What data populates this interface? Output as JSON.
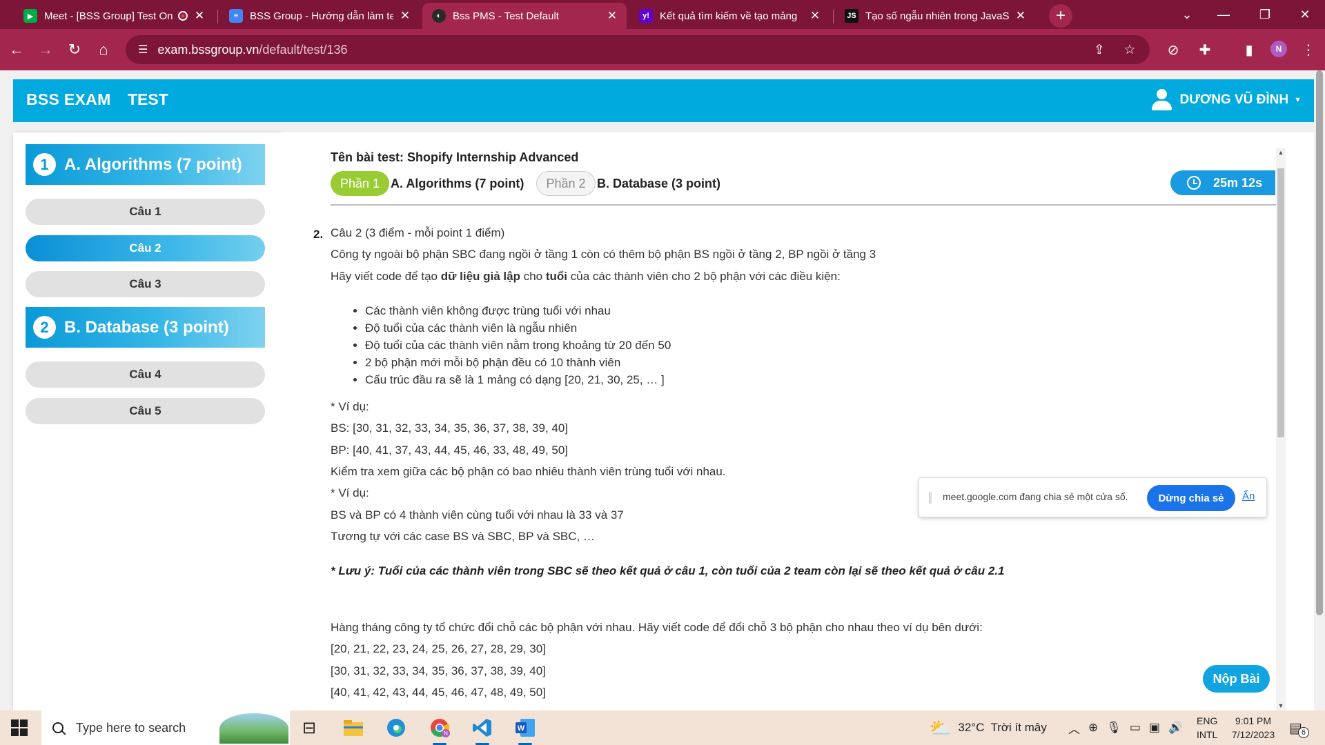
{
  "browser": {
    "tabs": [
      {
        "title": "Meet - [BSS Group] Test On",
        "favicon": "google-meet-icon",
        "color": "#00ac47",
        "recording": true,
        "active": false
      },
      {
        "title": "BSS Group - Hướng dẫn làm tes",
        "favicon": "google-docs-icon",
        "color": "#4285f4",
        "active": false
      },
      {
        "title": "Bss PMS - Test Default",
        "favicon": "bss-icon",
        "color": "#2a2a2a",
        "active": true
      },
      {
        "title": "Kết quả tìm kiếm về tạo mảng",
        "favicon": "yahoo-icon",
        "color": "#6001d2",
        "active": false
      },
      {
        "title": "Tạo số ngẫu nhiên trong JavaSc",
        "favicon": "js-icon",
        "color": "#111111",
        "active": false
      }
    ],
    "url_host": "exam.bssgroup.vn",
    "url_path": "/default/test/136",
    "profile_initial": "N"
  },
  "app": {
    "brand": "BSS EXAM",
    "nav_test": "TEST",
    "user_name": "DƯƠNG VŨ ĐÌNH"
  },
  "sidebar": {
    "sections": [
      {
        "num": "1",
        "title": "A. Algorithms (7 point)",
        "questions": [
          "Câu 1",
          "Câu 2",
          "Câu 3"
        ]
      },
      {
        "num": "2",
        "title": "B. Database (3 point)",
        "questions": [
          "Câu 4",
          "Câu 5"
        ]
      }
    ],
    "active_question": "Câu 2"
  },
  "test": {
    "name": "Tên bài test: Shopify Internship Advanced",
    "part1_pill": "Phần 1",
    "part1_label": "A. Algorithms (7 point)",
    "part2_pill": "Phần 2",
    "part2_label": "B. Database (3 point)",
    "timer": "25m 12s"
  },
  "question": {
    "number": "2.",
    "title": "Câu 2 (3 điểm - mỗi point 1 điểm)",
    "intro": "Công ty ngoài bộ phận SBC đang ngồi ở tầng 1 còn có thêm bộ phận BS ngồi ở tầng 2, BP ngồi ở tầng 3",
    "task_prefix": "Hãy viết code để tạo ",
    "task_bold1": "dữ liệu giả lập",
    "task_mid": " cho ",
    "task_bold2": "tuổi",
    "task_suffix": " của các thành viên cho 2 bộ phận với các điều kiện:",
    "conditions": [
      "Các thành viên không được trùng tuổi với nhau",
      "Độ tuổi của các thành viên là ngẫu nhiên",
      "Độ tuổi của các thành viên nằm trong khoảng từ 20 đến 50",
      "2 bộ phận mới mỗi bộ phận đều có 10 thành viên",
      "Cấu trúc đầu ra sẽ là 1 mảng có dạng [20, 21, 30, 25, … ]"
    ],
    "example_label": "* Ví dụ:",
    "bs_example": "BS: [30, 31, 32, 33, 34, 35, 36, 37, 38, 39, 40]",
    "bp_example": "BP: [40, 41, 37, 43, 44, 45, 46, 33, 48, 49, 50]",
    "check_text": "Kiểm tra xem giữa các bộ phận có bao nhiêu thành viên trùng tuổi với nhau.",
    "example_label2": "* Ví dụ:",
    "overlap_example": "BS và BP có 4 thành viên cùng tuổi với nhau là 33 và 37",
    "similar_text": "Tương tự với các case BS và SBC, BP và SBC, …",
    "note": "* Lưu ý: Tuổi của các thành viên trong SBC sẽ theo kết quả ở câu 1, còn tuổi của 2 team còn lại sẽ theo kết quả ở câu 2.1",
    "swap_text": "Hàng tháng công ty tổ chức đổi chỗ các bộ phận với nhau. Hãy viết code để đổi chỗ 3 bộ phận cho nhau theo ví dụ bên dưới:",
    "swap_lines": [
      "[20, 21, 22, 23, 24, 25, 26, 27, 28, 29, 30]",
      "[30, 31, 32, 33, 34, 35, 36, 37, 38, 39, 40]",
      "[40, 41, 42, 43, 44, 45, 46, 47, 48, 49, 50]"
    ]
  },
  "share_bar": {
    "message": "meet.google.com đang chia sẻ một cửa sổ.",
    "stop_label": "Dừng chia sẻ",
    "hide_label": "Ẩn"
  },
  "submit_label": "Nộp Bài",
  "taskbar": {
    "search_placeholder": "Type here to search",
    "weather": "32°C  Trời ít mây",
    "lang_line1": "ENG",
    "lang_line2": "INTL",
    "time": "9:01 PM",
    "date": "7/12/2023",
    "notif_count": "6"
  }
}
